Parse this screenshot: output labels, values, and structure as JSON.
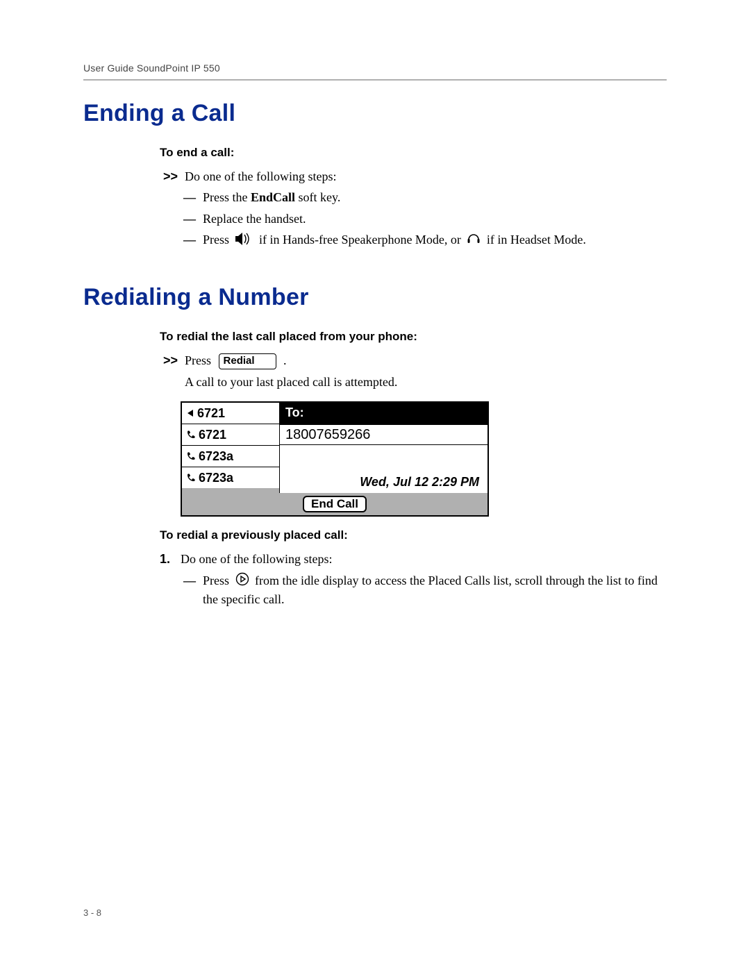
{
  "header": {
    "running_head": "User Guide SoundPoint IP 550"
  },
  "sections": {
    "ending": {
      "title": "Ending a Call",
      "subhead": "To end a call:",
      "step_marker": ">>",
      "step_text": "Do one of the following steps:",
      "dash1_pre": "Press the ",
      "dash1_strong": "EndCall",
      "dash1_post": " soft key.",
      "dash2": "Replace the handset.",
      "dash3_pre": "Press ",
      "dash3_mid": " if in Hands-free Speakerphone Mode, or ",
      "dash3_post": " if in Headset Mode."
    },
    "redial": {
      "title": "Redialing a Number",
      "subhead1": "To redial the last call placed from your phone:",
      "step1_marker": ">>",
      "step1_pre": "Press ",
      "step1_keycap": "Redial",
      "step1_post": " .",
      "step1_result": "A call to your last placed call is attempted.",
      "subhead2": "To redial a previously placed call:",
      "step2_marker": "1.",
      "step2_text": "Do one of the following steps:",
      "step2_dash_pre": "Press ",
      "step2_dash_post": " from the idle display to access the Placed Calls list, scroll through the list to find the specific call."
    }
  },
  "screen": {
    "lines": [
      "6721",
      "6721",
      "6723a",
      "6723a"
    ],
    "titlebar": "To:",
    "dialed": "18007659266",
    "datetime": "Wed, Jul 12  2:29 PM",
    "softkey": "End Call"
  },
  "footer": {
    "pagenum": "3 - 8"
  }
}
